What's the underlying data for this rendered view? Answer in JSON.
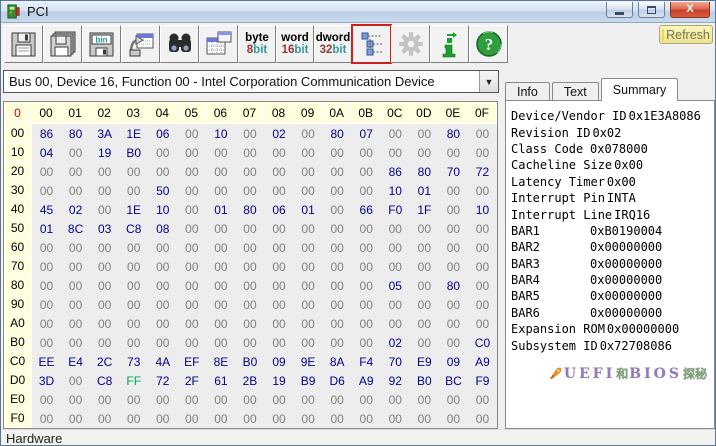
{
  "window": {
    "title": "PCI"
  },
  "toolbar": {
    "buttons": [
      {
        "name": "save"
      },
      {
        "name": "save-all"
      },
      {
        "name": "save-binary",
        "label": "bin"
      },
      {
        "name": "export"
      },
      {
        "name": "find"
      },
      {
        "name": "table-view"
      },
      {
        "name": "byte-mode",
        "top": "byte",
        "num": "8",
        "unit": "bit"
      },
      {
        "name": "word-mode",
        "top": "word",
        "num": "16",
        "unit": "bit"
      },
      {
        "name": "dword-mode",
        "top": "dword",
        "num": "32",
        "unit": "bit"
      },
      {
        "name": "tree-view",
        "selected": true
      },
      {
        "name": "settings",
        "disabled": true
      },
      {
        "name": "info"
      },
      {
        "name": "help",
        "glyph": "?"
      }
    ],
    "refresh_label": "Refresh"
  },
  "device_selector": {
    "value": "Bus 00, Device 16, Function 00 - Intel Corporation Communication Device"
  },
  "tabs": [
    {
      "label": "Info",
      "active": false
    },
    {
      "label": "Text",
      "active": false
    },
    {
      "label": "Summary",
      "active": true
    }
  ],
  "hex_grid": {
    "corner_label": "0",
    "col_headers": [
      "00",
      "01",
      "02",
      "03",
      "04",
      "05",
      "06",
      "07",
      "08",
      "09",
      "0A",
      "0B",
      "0C",
      "0D",
      "0E",
      "0F"
    ],
    "rows": [
      {
        "offset": "00",
        "values": [
          "86",
          "80",
          "3A",
          "1E",
          "06",
          "00",
          "10",
          "00",
          "02",
          "00",
          "80",
          "07",
          "00",
          "00",
          "80",
          "00"
        ]
      },
      {
        "offset": "10",
        "values": [
          "04",
          "00",
          "19",
          "B0",
          "00",
          "00",
          "00",
          "00",
          "00",
          "00",
          "00",
          "00",
          "00",
          "00",
          "00",
          "00"
        ]
      },
      {
        "offset": "20",
        "values": [
          "00",
          "00",
          "00",
          "00",
          "00",
          "00",
          "00",
          "00",
          "00",
          "00",
          "00",
          "00",
          "86",
          "80",
          "70",
          "72"
        ]
      },
      {
        "offset": "30",
        "values": [
          "00",
          "00",
          "00",
          "00",
          "50",
          "00",
          "00",
          "00",
          "00",
          "00",
          "00",
          "00",
          "10",
          "01",
          "00",
          "00"
        ]
      },
      {
        "offset": "40",
        "values": [
          "45",
          "02",
          "00",
          "1E",
          "10",
          "00",
          "01",
          "80",
          "06",
          "01",
          "00",
          "66",
          "F0",
          "1F",
          "00",
          "10"
        ]
      },
      {
        "offset": "50",
        "values": [
          "01",
          "8C",
          "03",
          "C8",
          "08",
          "00",
          "00",
          "00",
          "00",
          "00",
          "00",
          "00",
          "00",
          "00",
          "00",
          "00"
        ]
      },
      {
        "offset": "60",
        "values": [
          "00",
          "00",
          "00",
          "00",
          "00",
          "00",
          "00",
          "00",
          "00",
          "00",
          "00",
          "00",
          "00",
          "00",
          "00",
          "00"
        ]
      },
      {
        "offset": "70",
        "values": [
          "00",
          "00",
          "00",
          "00",
          "00",
          "00",
          "00",
          "00",
          "00",
          "00",
          "00",
          "00",
          "00",
          "00",
          "00",
          "00"
        ]
      },
      {
        "offset": "80",
        "values": [
          "00",
          "00",
          "00",
          "00",
          "00",
          "00",
          "00",
          "00",
          "00",
          "00",
          "00",
          "00",
          "05",
          "00",
          "80",
          "00"
        ]
      },
      {
        "offset": "90",
        "values": [
          "00",
          "00",
          "00",
          "00",
          "00",
          "00",
          "00",
          "00",
          "00",
          "00",
          "00",
          "00",
          "00",
          "00",
          "00",
          "00"
        ]
      },
      {
        "offset": "A0",
        "values": [
          "00",
          "00",
          "00",
          "00",
          "00",
          "00",
          "00",
          "00",
          "00",
          "00",
          "00",
          "00",
          "00",
          "00",
          "00",
          "00"
        ]
      },
      {
        "offset": "B0",
        "values": [
          "00",
          "00",
          "00",
          "00",
          "00",
          "00",
          "00",
          "00",
          "00",
          "00",
          "00",
          "00",
          "02",
          "00",
          "00",
          "C0"
        ]
      },
      {
        "offset": "C0",
        "values": [
          "EE",
          "E4",
          "2C",
          "73",
          "4A",
          "EF",
          "8E",
          "B0",
          "09",
          "9E",
          "8A",
          "F4",
          "70",
          "E9",
          "09",
          "A9"
        ]
      },
      {
        "offset": "D0",
        "values": [
          "3D",
          "00",
          "C8",
          "FF",
          "72",
          "2F",
          "61",
          "2B",
          "19",
          "B9",
          "D6",
          "A9",
          "92",
          "B0",
          "BC",
          "F9"
        ]
      },
      {
        "offset": "E0",
        "values": [
          "00",
          "00",
          "00",
          "00",
          "00",
          "00",
          "00",
          "00",
          "00",
          "00",
          "00",
          "00",
          "00",
          "00",
          "00",
          "00"
        ]
      },
      {
        "offset": "F0",
        "values": [
          "00",
          "00",
          "00",
          "00",
          "00",
          "00",
          "00",
          "00",
          "00",
          "00",
          "00",
          "00",
          "00",
          "00",
          "00",
          "00"
        ]
      }
    ],
    "value_colors": {
      "zero": "#808080",
      "nonzero": "#00008B",
      "ff": "#00A650",
      "corner": "#D40000"
    }
  },
  "summary": {
    "fields": [
      {
        "label": "Device/Vendor ID",
        "value": "0x1E3A8086"
      },
      {
        "label": "Revision ID",
        "value": "0x02"
      },
      {
        "label": "Class Code",
        "value": "0x078000"
      },
      {
        "label": "Cacheline Size",
        "value": "0x00"
      },
      {
        "label": "Latency Timer",
        "value": "0x00"
      },
      {
        "label": "Interrupt Pin",
        "value": "INTA"
      },
      {
        "label": "Interrupt Line",
        "value": "IRQ16"
      },
      {
        "label": "BAR1",
        "value": "0xB0190004"
      },
      {
        "label": "BAR2",
        "value": "0x00000000"
      },
      {
        "label": "BAR3",
        "value": "0x00000000"
      },
      {
        "label": "BAR4",
        "value": "0x00000000"
      },
      {
        "label": "BAR5",
        "value": "0x00000000"
      },
      {
        "label": "BAR6",
        "value": "0x00000000"
      },
      {
        "label": "Expansion ROM",
        "value": "0x00000000"
      },
      {
        "label": "Subsystem ID",
        "value": "0x72708086"
      }
    ]
  },
  "watermark": {
    "parts": [
      "UEFI",
      "和",
      "BIOS",
      "探秘"
    ]
  },
  "status_bar": {
    "text": "Hardware"
  }
}
